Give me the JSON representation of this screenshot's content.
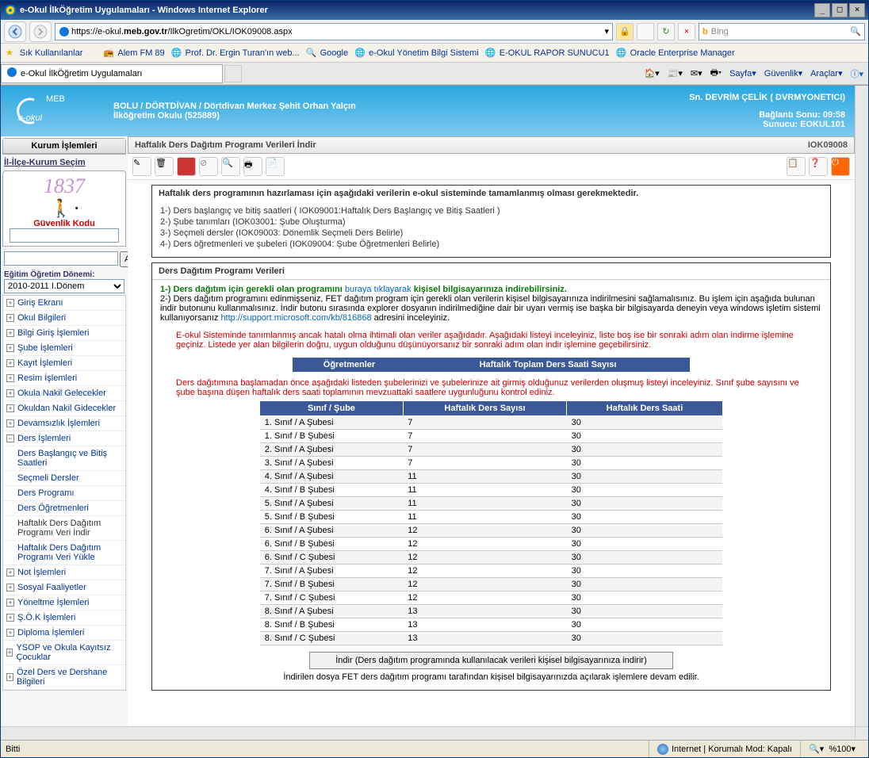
{
  "titlebar": {
    "title": "e-Okul İlkÖğretim Uygulamaları - Windows Internet Explorer"
  },
  "url": {
    "host": "meb.gov.tr",
    "prefix": "https://e-okul.",
    "suffix": "/IlkOgretim/OKL/IOK09008.aspx"
  },
  "search": {
    "placeholder": "Bing"
  },
  "favbar": {
    "label": "Sık Kullanılanlar",
    "items": [
      "Alem FM 89",
      "Prof. Dr. Ergin Turan'ın web...",
      "Google",
      "e-Okul Yönetim Bilgi Sistemi",
      "E-OKUL RAPOR SUNUCU1",
      "Oracle Enterprise Manager"
    ]
  },
  "tab": {
    "title": "e-Okul İlkÖğretim Uygulamaları"
  },
  "toptools": {
    "items": [
      "Sayfa",
      "Güvenlik",
      "Araçlar"
    ]
  },
  "banner": {
    "left1": "BOLU / DÖRTDİVAN / Dörtdivan Merkez Şehit Orhan Yalçın",
    "left2": "İlköğretim Okulu (525889)",
    "right1": "Sn. DEVRİM ÇELİK ( DVRMYONETICI)",
    "right2": "Bağlantı Sonu:  09:58",
    "right3": "Sunucu:  EOKUL101"
  },
  "sidebar": {
    "head": "Kurum İşlemleri",
    "ilce": "İl-İlçe-Kurum Seçim",
    "captcha": "1837",
    "seclabel": "Güvenlik Kodu",
    "ara": "Ara",
    "donemlabel": "Eğitim Öğretim Dönemi:",
    "donem": "2010-2011 I.Dönem",
    "nav": [
      "Giriş Ekranı",
      "Okul Bilgileri",
      "Bilgi Giriş İşlemleri",
      "Şube İşlemleri",
      "Kayıt İşlemleri",
      "Resim İşlemleri",
      "Okula Nakil Gelecekler",
      "Okuldan Nakil Gidecekler",
      "Devamsızlık İşlemleri",
      "Ders İşlemleri"
    ],
    "sub": [
      {
        "label": "Ders Başlangıç ve Bitiş Saatleri"
      },
      {
        "label": "Seçmeli Dersler"
      },
      {
        "label": "Ders Programı"
      },
      {
        "label": "Ders Öğretmenleri"
      },
      {
        "label": "Haftalık Ders Dağıtım Programı Veri İndir"
      },
      {
        "label": "Haftalık Ders Dağıtım Programı Veri Yükle"
      }
    ],
    "nav2": [
      "Not İşlemleri",
      "Sosyal Faaliyetler",
      "Yöneltme İşlemleri",
      "Ş.Ö.K İşlemleri",
      "Diploma İşlemleri",
      "YSOP ve Okula Kayıtsız Çocuklar",
      "Özel Ders ve Dershane Bilgileri"
    ]
  },
  "page": {
    "title": "Haftalık Ders Dağıtım Programı Verileri İndir",
    "code": "IOK09008",
    "panel1head": "Haftalık ders programının hazırlaması için aşağıdaki verilerin e-okul sisteminde tamamlanmış olması gerekmektedir.",
    "prereq": [
      "1-) Ders başlangıç ve bitiş saatleri (  IOK09001:Haftalık Ders Başlangıç ve Bitiş Saatleri )",
      "2-) Şube tanımları (IOK03001: Şube Oluşturma)",
      "3-) Seçmeli dersler (IOK09003:  Dönemlik Seçmeli Ders Belirle)",
      "4-) Ders öğretmenleri ve şubeleri (IOK09004:  Şube Öğretmenleri Belirle)"
    ],
    "panel2head": "Ders Dağıtım Programı Verileri",
    "step1a": "1-) Ders dağıtım için gerekli olan programını",
    "step1link": "buraya tıklayarak",
    "step1b": "kişisel bilgisayarınıza indirebilirsiniz.",
    "step2": " 2-) Ders dağıtım programını edinmişseniz, FET dağıtım program için gerekli olan verilerin kişisel bilgisayarınıza indirilmesini sağlamalısınız. Bu işlem için aşağıda bulunan indir butonunu kullanmalısınız. İndir butonu sırasında explorer dosyanın indirilmediğine dair bir uyarı vermiş ise başka bir bilgisayarda deneyin veya windows işletim sistemi kullanıyorsanız  ",
    "kblink": "http://support.microsoft.com/kb/816868",
    "step2b": " adresini inceleyiniz.",
    "warn": "E-okul Sisteminde tanımlanmış ancak hatalı olma ihtimali olan veriler aşağıdadır. Aşağıdaki listeyi inceleyiniz, liste boş ise bir sonraki adım olan indirme işlemine geçiniz. Listede yer alan bilgilerin doğru, uygun olduğunu düşünüyorsanız bir sonraki adım olan indir işlemine geçebilirsiniz.",
    "th1": "Öğretmenler",
    "th2": "Haftalık Toplam Ders Saati Sayısı",
    "warn2": "Ders dağıtımına başlamadan önce aşağıdaki listeden şubelerinizi ve şubelerinize ait girmiş olduğunuz verilerden oluşmuş listeyi inceleyiniz. Sınıf şube sayısını ve şube başına düşen haftalık ders saati toplamının mevzuattaki saatlere uygunluğunu kontrol ediniz.",
    "col1": "Sınıf / Şube",
    "col2": "Haftalık Ders Sayısı",
    "col3": "Haftalık Ders Saati",
    "rows": [
      {
        "s": "1. Sınıf / A Şubesi",
        "d": "7",
        "h": "30"
      },
      {
        "s": "1. Sınıf / B Şubesi",
        "d": "7",
        "h": "30"
      },
      {
        "s": "2. Sınıf / A Şubesi",
        "d": "7",
        "h": "30"
      },
      {
        "s": "3. Sınıf / A Şubesi",
        "d": "7",
        "h": "30"
      },
      {
        "s": "4. Sınıf / A Şubesi",
        "d": "11",
        "h": "30"
      },
      {
        "s": "4. Sınıf / B Şubesi",
        "d": "11",
        "h": "30"
      },
      {
        "s": "5. Sınıf / A Şubesi",
        "d": "11",
        "h": "30"
      },
      {
        "s": "5. Sınıf / B Şubesi",
        "d": "11",
        "h": "30"
      },
      {
        "s": "6. Sınıf / A Şubesi",
        "d": "12",
        "h": "30"
      },
      {
        "s": "6. Sınıf / B Şubesi",
        "d": "12",
        "h": "30"
      },
      {
        "s": "6. Sınıf / C Şubesi",
        "d": "12",
        "h": "30"
      },
      {
        "s": "7. Sınıf / A Şubesi",
        "d": "12",
        "h": "30"
      },
      {
        "s": "7. Sınıf / B Şubesi",
        "d": "12",
        "h": "30"
      },
      {
        "s": "7. Sınıf / C Şubesi",
        "d": "12",
        "h": "30"
      },
      {
        "s": "8. Sınıf / A Şubesi",
        "d": "13",
        "h": "30"
      },
      {
        "s": "8. Sınıf / B Şubesi",
        "d": "13",
        "h": "30"
      },
      {
        "s": "8. Sınıf / C Şubesi",
        "d": "13",
        "h": "30"
      }
    ],
    "dlbtn": "İndir (Ders dağıtım programında kullanılacak verileri kişisel bilgisayarınıza indirir)",
    "dlinfo": "İndirilen dosya FET ders dağıtım programı tarafından kişisel bilgisayarınızda açılarak işlemlere devam edilir."
  },
  "status": {
    "left": "Bitti",
    "mode": "Internet | Korumalı Mod: Kapalı",
    "zoom": "%100"
  }
}
